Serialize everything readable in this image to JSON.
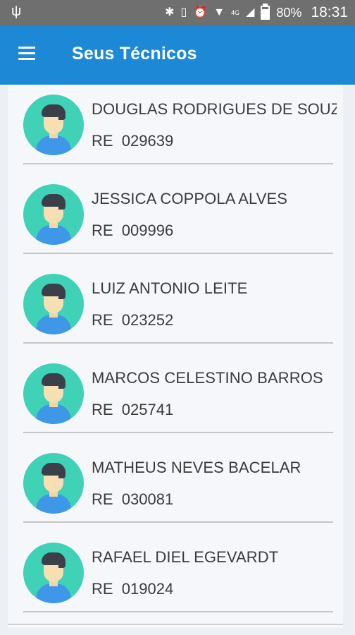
{
  "status_bar": {
    "battery": "80%",
    "time": "18:31",
    "network_label": "4G",
    "battery_level": 0.8
  },
  "app_bar": {
    "title": "Seus Técnicos"
  },
  "technicians": [
    {
      "name": "DOUGLAS RODRIGUES DE SOUZA",
      "re_label": "RE",
      "re": "029639"
    },
    {
      "name": "JESSICA COPPOLA ALVES",
      "re_label": "RE",
      "re": "009996"
    },
    {
      "name": "LUIZ ANTONIO LEITE",
      "re_label": "RE",
      "re": "023252"
    },
    {
      "name": "MARCOS CELESTINO BARROS",
      "re_label": "RE",
      "re": "025741"
    },
    {
      "name": "MATHEUS NEVES BACELAR",
      "re_label": "RE",
      "re": "030081"
    },
    {
      "name": "RAFAEL DIEL EGEVARDT",
      "re_label": "RE",
      "re": "019024"
    }
  ],
  "colors": {
    "status_bar": "#6f6f6f",
    "app_bar": "#1c88d6",
    "avatar_bg": "#3fd2b6",
    "avatar_shirt": "#3f97e8"
  }
}
